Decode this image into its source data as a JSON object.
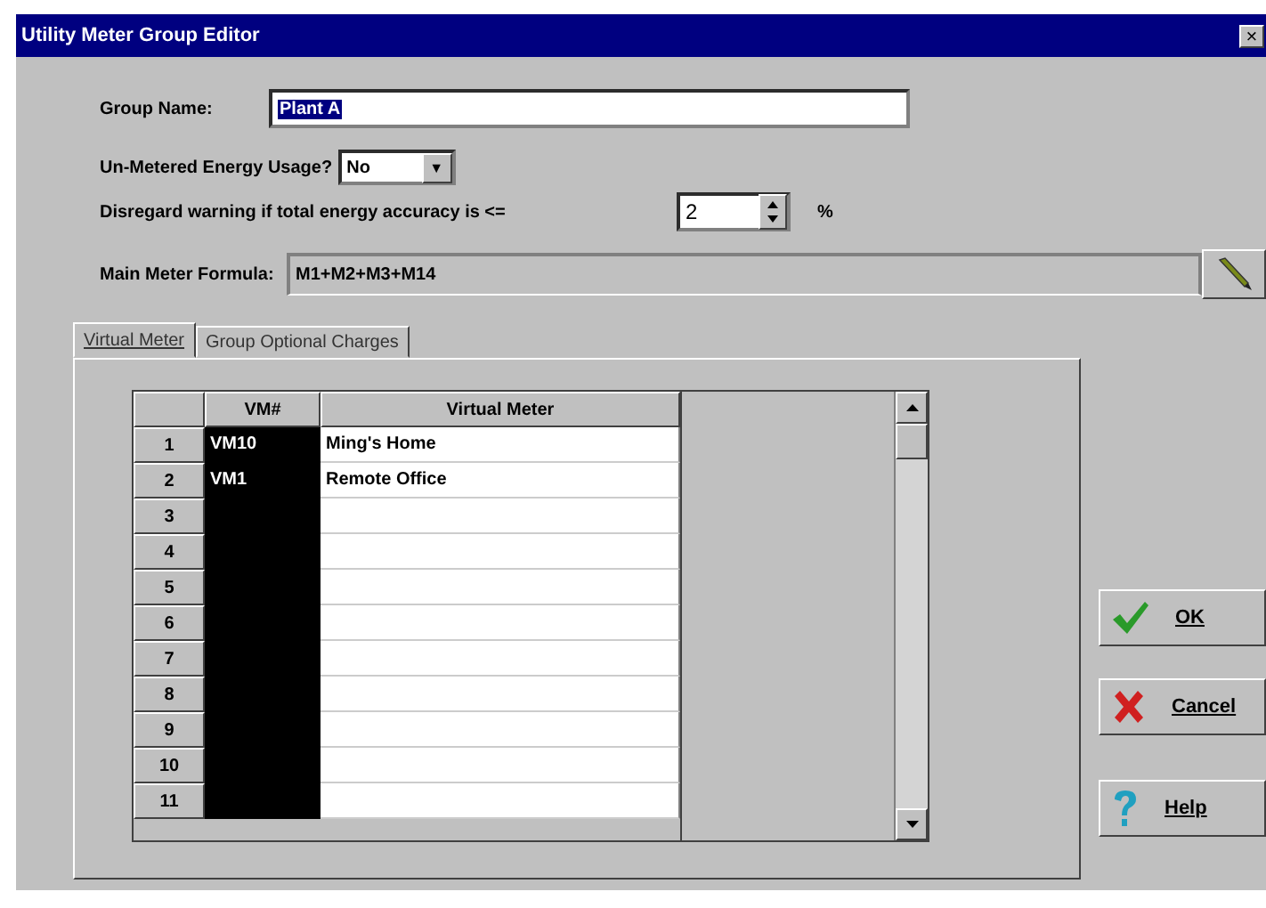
{
  "window": {
    "title": "Utility Meter Group Editor",
    "close": "×"
  },
  "group_name": {
    "label": "Group Name:",
    "value": "Plant A",
    "highlighted": true
  },
  "unmetered": {
    "label": "Un-Metered Energy Usage?",
    "value": "No",
    "arrow": "▼"
  },
  "accuracy": {
    "label": "Disregard warning if total energy accuracy is <=",
    "value": "2",
    "unit": "%"
  },
  "formula": {
    "label": "Main Meter Formula:",
    "value": "M1+M2+M3+M14"
  },
  "tabs": [
    {
      "label": "Virtual Meter",
      "selected": true
    },
    {
      "label": "Group Optional Charges",
      "selected": false
    }
  ],
  "table": {
    "columns": [
      {
        "label": "VM#",
        "selected": true
      },
      {
        "label": "Virtual Meter",
        "selected": false
      }
    ],
    "rows": [
      {
        "number": "1",
        "vm": "VM10",
        "name": "Ming's Home"
      },
      {
        "number": "2",
        "vm": "VM1",
        "name": "Remote Office"
      },
      {
        "number": "3"
      },
      {
        "number": "4"
      },
      {
        "number": "5"
      },
      {
        "number": "6"
      },
      {
        "number": "7"
      },
      {
        "number": "8"
      },
      {
        "number": "9"
      },
      {
        "number": "10"
      },
      {
        "number": "11"
      }
    ]
  },
  "buttons": [
    {
      "kind": "ok",
      "label": "OK"
    },
    {
      "kind": "cancel",
      "label": "Cancel"
    },
    {
      "kind": "help",
      "label": "Help"
    }
  ]
}
